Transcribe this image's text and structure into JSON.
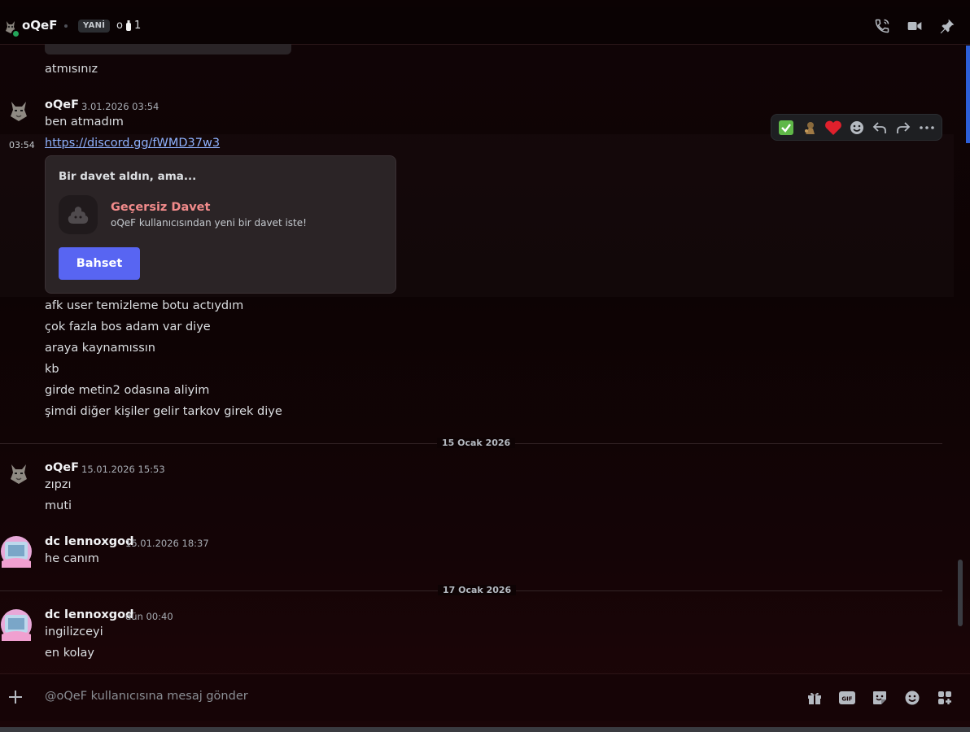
{
  "header": {
    "name": "oQeF",
    "tag": "YANİ",
    "extra_prefix": "o",
    "extra_count": "1"
  },
  "messages": {
    "prev_text": "atmısınız",
    "group1": {
      "author": "oQeF",
      "timestamp": "3.01.2026 03:54",
      "line1": "ben atmadım",
      "side_time": "03:54",
      "link": "https://discord.gg/fWMD37w3",
      "lines": [
        "afk user temizleme botu actıydım",
        "çok fazla bos adam var diye",
        "araya kaynamıssın",
        "kb",
        "girde metin2 odasına aliyim",
        "şimdi diğer kişiler gelir tarkov girek diye"
      ]
    },
    "invite": {
      "heading": "Bir davet aldın, ama...",
      "title": "Geçersiz Davet",
      "subtitle": "oQeF kullanıcısından yeni bir davet iste!",
      "button": "Bahset"
    },
    "divider1": "15 Ocak 2026",
    "group2": {
      "author": "oQeF",
      "timestamp": "15.01.2026 15:53",
      "lines": [
        "zıpzı",
        "muti"
      ]
    },
    "group3": {
      "author": "dc lennoxgod",
      "timestamp": "15.01.2026 18:37",
      "lines": [
        "he canım"
      ]
    },
    "divider2": "17 Ocak 2026",
    "group4": {
      "author": "dc lennoxgod",
      "timestamp": "dün 00:40",
      "lines": [
        "ingilizceyi",
        "en kolay"
      ]
    }
  },
  "composer": {
    "placeholder": "@oQeF kullanıcısına mesaj gönder"
  },
  "icons": {
    "header": [
      "voice-call-icon",
      "video-call-icon",
      "pin-icon"
    ],
    "toolbar": [
      "check-emoji-icon",
      "custom-emoji-icon",
      "heart-emoji-icon",
      "add-reaction-icon",
      "reply-icon",
      "forward-icon",
      "more-icon"
    ],
    "composer": [
      "gift-icon",
      "gif-icon",
      "sticker-icon",
      "emoji-icon",
      "apps-icon"
    ]
  },
  "colors": {
    "accent": "#5865f2",
    "invalid_invite": "#f28b8b",
    "link": "#8fb2ff",
    "online": "#23a55a"
  }
}
